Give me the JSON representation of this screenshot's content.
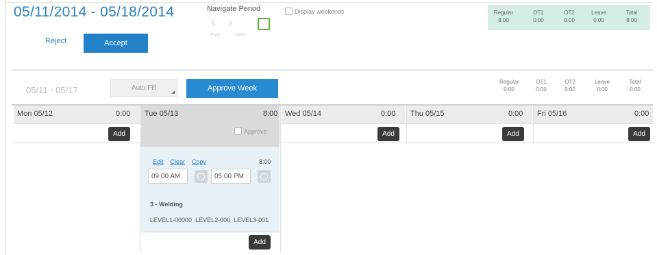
{
  "header": {
    "date_range": "05/11/2014 - 05/18/2014",
    "reject_label": "Reject",
    "accept_label": "Accept",
    "navigate_title": "Navigate Period",
    "prev_label": "Prev",
    "next_label": "Next",
    "display_weekends_label": "Display weekends"
  },
  "summary_top": [
    {
      "label": "Regular",
      "value": "8:00"
    },
    {
      "label": "OT1",
      "value": "0:00"
    },
    {
      "label": "OT2",
      "value": "0:00"
    },
    {
      "label": "Leave",
      "value": "0:00"
    },
    {
      "label": "Total",
      "value": "8:00"
    }
  ],
  "week_bar": {
    "range": "05/11 - 05/17",
    "autofill_label": "Auto Fill",
    "approve_week_label": "Approve Week"
  },
  "summary_week": [
    {
      "label": "Regular",
      "value": "0:00"
    },
    {
      "label": "OT1",
      "value": "0:00"
    },
    {
      "label": "OT2",
      "value": "0:00"
    },
    {
      "label": "Leave",
      "value": "0:00"
    },
    {
      "label": "Total",
      "value": "0:00"
    }
  ],
  "days": [
    {
      "label": "Mon 05/12",
      "hours": "0:00",
      "add": "Add"
    },
    {
      "label": "Tue 05/13",
      "hours": "8:00",
      "add": "Add",
      "approve_label": "Approve"
    },
    {
      "label": "Wed 05/14",
      "hours": "0:00",
      "add": "Add"
    },
    {
      "label": "Thu 05/15",
      "hours": "0:00",
      "add": "Add"
    },
    {
      "label": "Fri 05/16",
      "hours": "0:00",
      "add": "Add"
    }
  ],
  "entry": {
    "edit": "Edit",
    "clear": "Clear",
    "copy": "Copy",
    "hours": "8:00",
    "start_time": "09:00 AM",
    "end_time": "05:00 PM",
    "job": "3 - Welding",
    "levels": [
      "LEVEL1-00000",
      "LEVEL2-000",
      "LEVEL3-001"
    ]
  },
  "colors": {
    "accent": "#2281c9",
    "summary_bg": "#d6ede6",
    "entry_bg": "#e8f1f6",
    "nav_box": "#5ea83c"
  }
}
